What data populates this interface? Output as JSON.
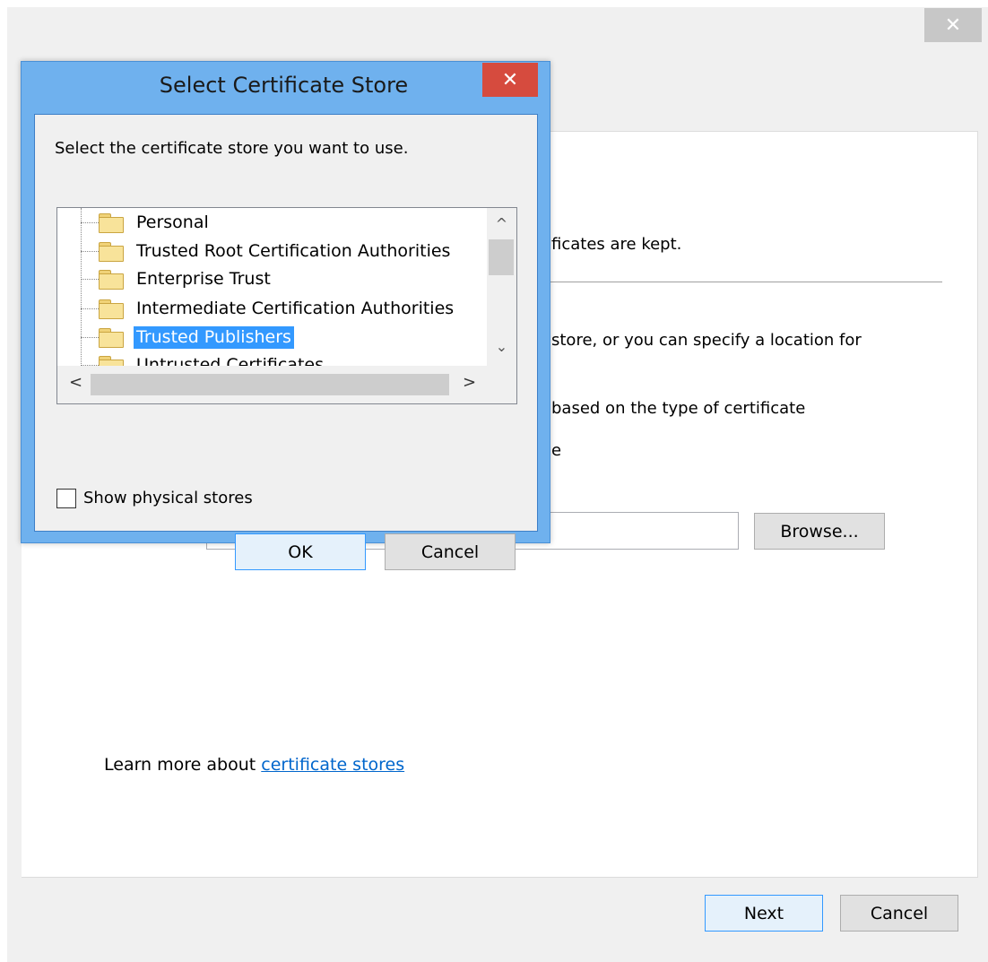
{
  "wizard": {
    "close_glyph": "✕",
    "fragment_kept": "ficates are kept.",
    "fragment_store": "store, or you can specify a location for",
    "fragment_type": "based on the type of certificate",
    "fragment_e": "e",
    "path_value": "",
    "browse_label": "Browse...",
    "learn_more_prefix": "Learn more about ",
    "learn_more_link": "certificate stores",
    "next_label": "Next",
    "cancel_label": "Cancel"
  },
  "dialog": {
    "title": "Select Certificate Store",
    "close_glyph": "✕",
    "prompt": "Select the certificate store you want to use.",
    "stores": [
      {
        "label": "Personal",
        "selected": false
      },
      {
        "label": "Trusted Root Certification Authorities",
        "selected": false
      },
      {
        "label": "Enterprise Trust",
        "selected": false
      },
      {
        "label": "Intermediate Certification Authorities",
        "selected": false
      },
      {
        "label": "Trusted Publishers",
        "selected": true
      },
      {
        "label": "Untrusted Certificates",
        "selected": false
      }
    ],
    "scroll_up": "^",
    "scroll_down": "⌄",
    "scroll_left": "<",
    "scroll_right": ">",
    "show_physical_label": "Show physical stores",
    "show_physical_checked": false,
    "ok_label": "OK",
    "cancel_label": "Cancel"
  },
  "colors": {
    "dialog_frame": "#6fb1ee",
    "close_red": "#d64b3e",
    "selection": "#3399ff",
    "link": "#0066cc"
  }
}
